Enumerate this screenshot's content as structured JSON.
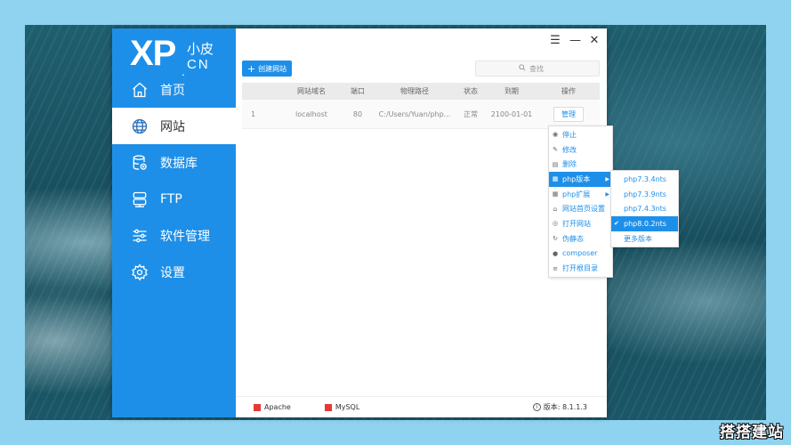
{
  "brand": {
    "logo_main": "XP",
    "logo_cn_top": "小皮",
    "logo_dot": ".",
    "logo_cn_bottom": "CN"
  },
  "window_controls": {
    "menu": "☰",
    "minimize": "—",
    "close": "✕"
  },
  "sidebar": {
    "items": [
      {
        "label": "首页",
        "icon": "home-icon"
      },
      {
        "label": "网站",
        "icon": "globe-icon",
        "active": true
      },
      {
        "label": "数据库",
        "icon": "database-icon"
      },
      {
        "label": "FTP",
        "icon": "ftp-server-icon"
      },
      {
        "label": "软件管理",
        "icon": "sliders-icon"
      },
      {
        "label": "设置",
        "icon": "gear-icon"
      }
    ]
  },
  "toolbar": {
    "create_label": "创建网站",
    "search_placeholder": "查找"
  },
  "table": {
    "headers": [
      "网站域名",
      "端口",
      "物理路径",
      "状态",
      "到期",
      "操作"
    ],
    "rows": [
      {
        "id": "1",
        "domain": "localhost",
        "port": "80",
        "path": "C:/Users/Yuan/php...",
        "status": "正常",
        "expire": "2100-01-01",
        "action": "管理"
      }
    ]
  },
  "context_menu": {
    "items": [
      {
        "label": "停止",
        "icon": "stop-icon"
      },
      {
        "label": "修改",
        "icon": "edit-icon"
      },
      {
        "label": "删除",
        "icon": "trash-icon"
      },
      {
        "label": "php版本",
        "icon": "grid-icon",
        "highlighted": true,
        "has_submenu": true
      },
      {
        "label": "php扩展",
        "icon": "grid-icon",
        "has_submenu": true
      },
      {
        "label": "网站首页设置",
        "icon": "home-icon"
      },
      {
        "label": "打开网站",
        "icon": "globe-icon"
      },
      {
        "label": "伪静态",
        "icon": "refresh-icon"
      },
      {
        "label": "composer",
        "icon": "package-icon"
      },
      {
        "label": "打开根目录",
        "icon": "list-icon"
      }
    ]
  },
  "php_submenu": {
    "items": [
      {
        "label": "php7.3.4nts"
      },
      {
        "label": "php7.3.9nts"
      },
      {
        "label": "php7.4.3nts"
      },
      {
        "label": "php8.0.2nts",
        "selected": true
      },
      {
        "label": "更多版本"
      }
    ]
  },
  "footer": {
    "services": [
      {
        "label": "Apache",
        "color": "#e53935"
      },
      {
        "label": "MySQL",
        "color": "#e53935"
      }
    ],
    "version_label": "版本: 8.1.1.3"
  },
  "watermark": "搭搭建站",
  "colors": {
    "accent": "#1e8fe8",
    "stopped": "#e53935"
  }
}
